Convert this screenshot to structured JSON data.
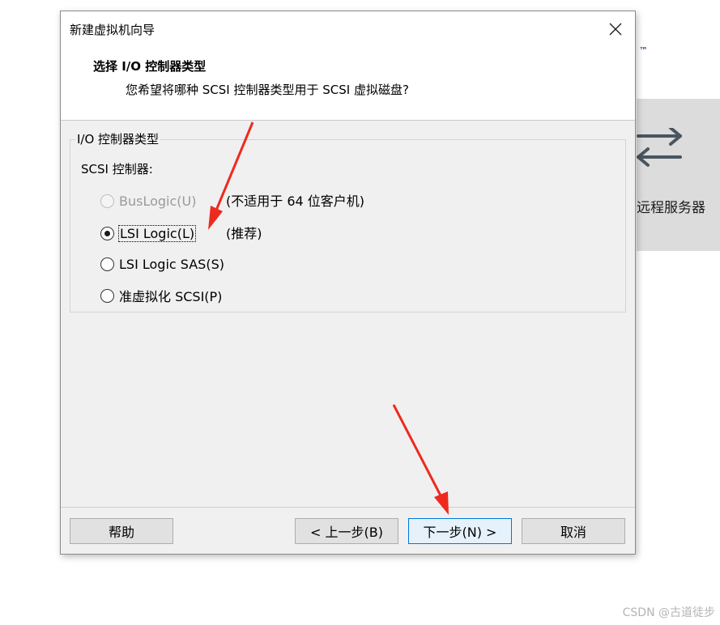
{
  "background_app": {
    "trademark": "™",
    "remote_server_label": "远程服务器",
    "icon": "transfer-arrows-icon"
  },
  "dialog": {
    "title": "新建虚拟机向导",
    "close_icon": "close-icon",
    "header_title": "选择 I/O 控制器类型",
    "header_subtitle": "您希望将哪种 SCSI 控制器类型用于 SCSI 虚拟磁盘?",
    "group_title": "I/O 控制器类型",
    "field_label": "SCSI 控制器:",
    "options": [
      {
        "label": "BusLogic(U)",
        "note": "(不适用于 64 位客户机)",
        "checked": false,
        "disabled": true
      },
      {
        "label": "LSI Logic(L)",
        "note": "(推荐)",
        "checked": true,
        "disabled": false
      },
      {
        "label": "LSI Logic SAS(S)",
        "note": "",
        "checked": false,
        "disabled": false
      },
      {
        "label": "准虚拟化 SCSI(P)",
        "note": "",
        "checked": false,
        "disabled": false
      }
    ],
    "buttons": {
      "help": "帮助",
      "back": "< 上一步(B)",
      "next": "下一步(N) >",
      "cancel": "取消"
    }
  },
  "annotation_color": "#ee2a1f",
  "watermark": "CSDN @古道徒步"
}
